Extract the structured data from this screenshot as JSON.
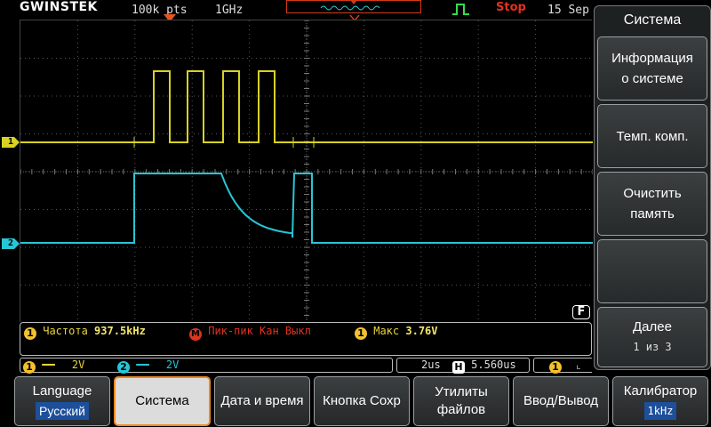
{
  "topbar": {
    "brand": "GWINSTEK",
    "record_length": "100k pts",
    "sample_rate": "1GHz",
    "run_state": "Stop",
    "date": "15 Sep"
  },
  "grid": {
    "ch1_marker": "1",
    "ch2_marker": "2",
    "fine_badge": "F"
  },
  "measurements": {
    "m1_source": "1",
    "m1_label": "Частота",
    "m1_value": "937.5kHz",
    "m2_source": "M",
    "m2_label": "Пик-пик Кан Выкл",
    "m3_source": "1",
    "m3_label": "Макс",
    "m3_value": "3.76V"
  },
  "status": {
    "ch1_num": "1",
    "ch1_scale": "2V",
    "ch2_num": "2",
    "ch2_scale": "2V",
    "timebase": "2us",
    "h_icon": "H",
    "h_position": "5.560us",
    "trig_source": "1"
  },
  "side_menu": {
    "title": "Система",
    "buttons": [
      {
        "line1": "Информация",
        "line2": "о системе"
      },
      {
        "line1": "Темп. комп.",
        "line2": ""
      },
      {
        "line1": "Очистить",
        "line2": "память"
      },
      {
        "line1": "",
        "line2": ""
      },
      {
        "line1": "Далее",
        "line2": "1 из 3"
      }
    ]
  },
  "bottom_menu": {
    "language_label": "Language",
    "language_value": "Русский",
    "system": "Система",
    "datetime": "Дата и время",
    "save_button": "Кнопка Сохр",
    "file_util_1": "Утилиты",
    "file_util_2": "файлов",
    "io": "Ввод/Вывод",
    "calibrator": "Калибратор",
    "calibrator_value": "1kHz"
  },
  "colors": {
    "ch1": "#d8d224",
    "ch2": "#27c6d6",
    "stop": "#e0331e",
    "highlight": "#f08a1e"
  }
}
